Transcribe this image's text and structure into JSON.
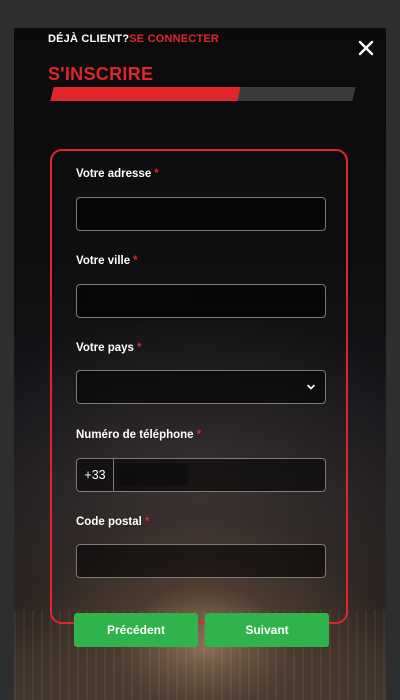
{
  "header": {
    "already_client": "DÉJÀ CLIENT?",
    "login_link": "SE CONNECTER",
    "close_icon": "close-icon"
  },
  "title": "S'INSCRIRE",
  "progress": {
    "fraction": 0.62,
    "fill_color": "#e0252b",
    "track_color": "#3a3a3a"
  },
  "form": {
    "address": {
      "label": "Votre adresse",
      "required_mark": "*",
      "value": ""
    },
    "city": {
      "label": "Votre ville",
      "required_mark": "*",
      "value": ""
    },
    "country": {
      "label": "Votre pays",
      "required_mark": "*",
      "selected": "",
      "icon": "chevron-down-icon"
    },
    "phone": {
      "label": "Numéro de téléphone",
      "required_mark": "*",
      "prefix": "+33",
      "value": ""
    },
    "postal": {
      "label": "Code postal",
      "required_mark": "*",
      "value": ""
    }
  },
  "buttons": {
    "previous": "Précédent",
    "next": "Suivant"
  },
  "colors": {
    "accent": "#e0252b",
    "button": "#2fb44b"
  }
}
